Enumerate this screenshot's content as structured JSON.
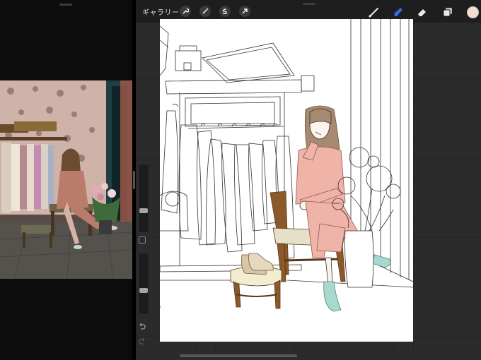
{
  "toolbar": {
    "gallery_label": "ギャラリー",
    "left_tools": [
      "wrench-icon",
      "magic-wand-icon",
      "selection-icon",
      "transform-arrow-icon"
    ],
    "right_tools": [
      "brush-icon",
      "smudge-icon",
      "eraser-icon",
      "layers-icon"
    ],
    "active_tool": "smudge-icon",
    "active_color": "#f2ddd0",
    "accent_color": "#2f6fe8"
  },
  "sidebar": {
    "brush_size_level": 0.35,
    "opacity_level": 0.35,
    "controls": [
      "brush-size-slider",
      "modify-button",
      "opacity-slider",
      "undo-icon",
      "redo-icon"
    ]
  },
  "reference": {
    "description_colors": {
      "wall": "#c9a9a0",
      "dress": "#c98a78"
    }
  }
}
